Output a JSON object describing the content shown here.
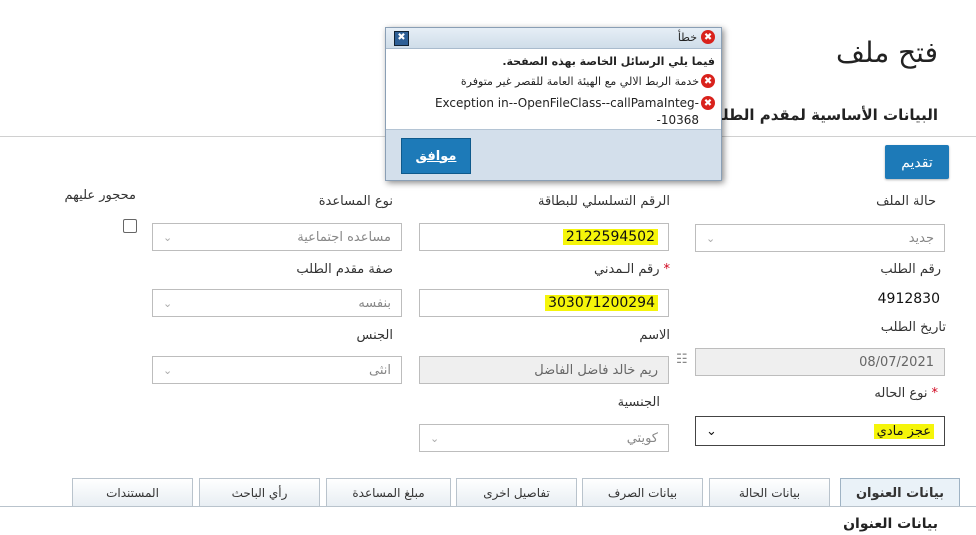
{
  "page": {
    "title": "فتح ملف",
    "section_title": "البيانات الأساسية لمقدم الطلب",
    "submit_label": "تقديم"
  },
  "form": {
    "file_status": {
      "label": "حالة الملف",
      "value": "جديد"
    },
    "card_serial": {
      "label": "الرقم التسلسلي للبطاقة",
      "value": "2122594502"
    },
    "assistance_type": {
      "label": "نوع المساعدة",
      "value": "مساعده اجتماعية"
    },
    "under_guardianship": {
      "label": "محجور عليهم",
      "checked": false
    },
    "request_number": {
      "label": "رقم الطلب",
      "value": "4912830"
    },
    "civil_id": {
      "label": "رقم الـمدني",
      "value": "303071200294"
    },
    "applicant_capacity": {
      "label": "صفة مقدم الطلب",
      "value": "بنفسه"
    },
    "request_date": {
      "label": "تاريخ الطلب",
      "value": "08/07/2021"
    },
    "name": {
      "label": "الاسم",
      "value": "ريم خالد فاضل الفاضل"
    },
    "gender": {
      "label": "الجنس",
      "value": "انثى"
    },
    "case_type": {
      "label": "نوع الحاله",
      "value": "عجز مادي"
    },
    "nationality": {
      "label": "الجنسية",
      "value": "كويتي"
    }
  },
  "tabs": [
    {
      "label": "بيانات العنوان",
      "active": true
    },
    {
      "label": "بيانات الحالة",
      "active": false
    },
    {
      "label": "بيانات الصرف",
      "active": false
    },
    {
      "label": "تفاصيل اخرى",
      "active": false
    },
    {
      "label": "مبلغ المساعدة",
      "active": false
    },
    {
      "label": "رأي الباحث",
      "active": false
    },
    {
      "label": "المستندات",
      "active": false
    }
  ],
  "tab_section_title": "بيانات العنوان",
  "dialog": {
    "title": "خطأ",
    "header_text": "فيما يلي الرسائل الخاصة بهذه الصفحة.",
    "messages": [
      "خدمة الربط الالي مع الهيئة العامة للقصر غير متوفرة",
      "Exception in--OpenFileClass--callPamaInteg-",
      "-10368"
    ],
    "ok_label": "موافق"
  },
  "colors": {
    "primary_button": "#1d7ab8",
    "highlight": "#f5f50a",
    "required": "#d0021b",
    "error_icon": "#d9221c"
  }
}
